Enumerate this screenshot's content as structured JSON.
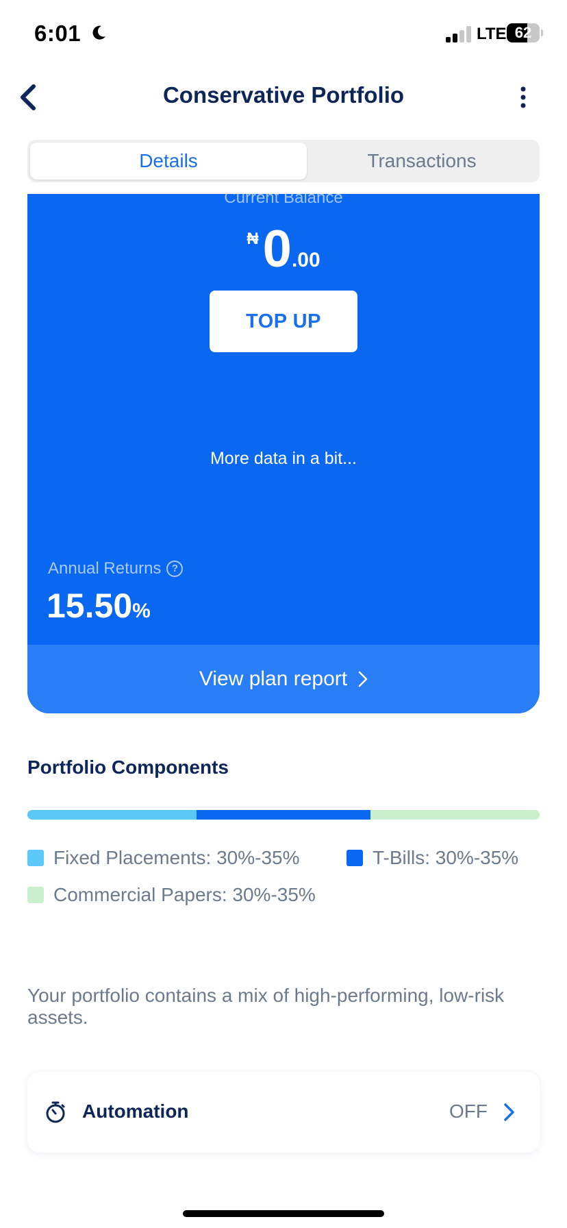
{
  "status_bar": {
    "time": "6:01",
    "network": "LTE",
    "battery_level": "62",
    "battery_fraction": 0.62,
    "signal_bars": 2,
    "icons": [
      "moon-icon",
      "signal-icon",
      "battery-icon"
    ]
  },
  "nav": {
    "title": "Conservative Portfolio",
    "back_icon": "chevron-left-icon",
    "more_icon": "vertical-dots-icon"
  },
  "tabs": [
    {
      "label": "Details",
      "active": true
    },
    {
      "label": "Transactions",
      "active": false
    }
  ],
  "balance": {
    "label": "Current Balance",
    "currency": "₦",
    "whole": "0",
    "decimal": ".00",
    "top_up_label": "TOP UP",
    "pending_text": "More data in a bit...",
    "annual_returns_label": "Annual Returns",
    "annual_returns_value": "15.50",
    "annual_returns_unit": "%",
    "report_link": "View plan report",
    "help_icon": "question-circle-icon"
  },
  "components": {
    "title": "Portfolio Components",
    "items": [
      {
        "label": "Fixed Placements: 30%-35%",
        "color": "#5bc8f7",
        "share": 0.33
      },
      {
        "label": "T-Bills: 30%-35%",
        "color": "#0a67f0",
        "share": 0.34
      },
      {
        "label": "Commercial Papers: 30%-35%",
        "color": "#c9f0cc",
        "share": 0.33
      }
    ]
  },
  "description": "Your portfolio contains a mix of high-performing, low-risk assets.",
  "automation": {
    "label": "Automation",
    "status": "OFF",
    "icon": "stopwatch-icon"
  },
  "colors": {
    "primary_blue": "#0a67f0",
    "link_blue": "#1a6ef0",
    "navy": "#0d2557",
    "muted": "#6c7a8e"
  }
}
